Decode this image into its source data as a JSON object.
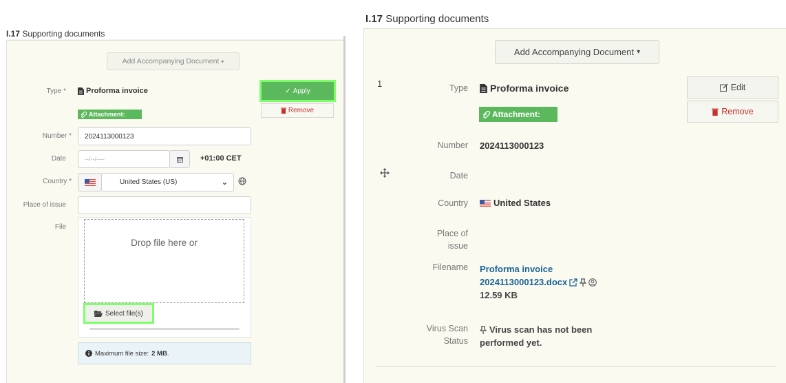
{
  "left": {
    "title_num": "I.17",
    "title_text": "Supporting documents",
    "add_doc_label": "Add Accompanying Document",
    "type_label": "Type",
    "type_value": "Proforma invoice",
    "attachment_label": "Attachment:",
    "apply_label": "Apply",
    "remove_label": "Remove",
    "number_label": "Number",
    "number_value": "2024113000123",
    "date_label": "Date",
    "date_placeholder": "--/--/----",
    "timezone": "+01:00 CET",
    "country_label": "Country",
    "country_value": "United States (US)",
    "place_label": "Place of issue",
    "place_value": "",
    "file_label": "File",
    "drop_text": "Drop file here or",
    "select_files_label": "Select file(s)",
    "max_size_label": "Maximum file size:",
    "max_size_value": "2 MB",
    "max_size_suffix": "."
  },
  "right": {
    "title_num": "I.17",
    "title_text": "Supporting documents",
    "add_doc_label": "Add Accompanying Document",
    "index": "1",
    "type_label": "Type",
    "type_value": "Proforma invoice",
    "edit_label": "Edit",
    "remove_label": "Remove",
    "attachment_label": "Attachment:",
    "number_label": "Number",
    "number_value": "2024113000123",
    "date_label": "Date",
    "country_label": "Country",
    "country_value": "United States",
    "place_label_1": "Place of",
    "place_label_2": "issue",
    "filename_label": "Filename",
    "filename_line1": "Proforma invoice",
    "filename_line2": "2024113000123.docx",
    "file_size": "12.59 KB",
    "virus_label_1": "Virus Scan",
    "virus_label_2": "Status",
    "virus_text_1": "Virus scan has not been",
    "virus_text_2": "performed yet."
  },
  "colors": {
    "accent_green": "#5cb85c",
    "highlight_green": "#7dff6a",
    "danger": "#c9302c",
    "link": "#1a6496"
  }
}
